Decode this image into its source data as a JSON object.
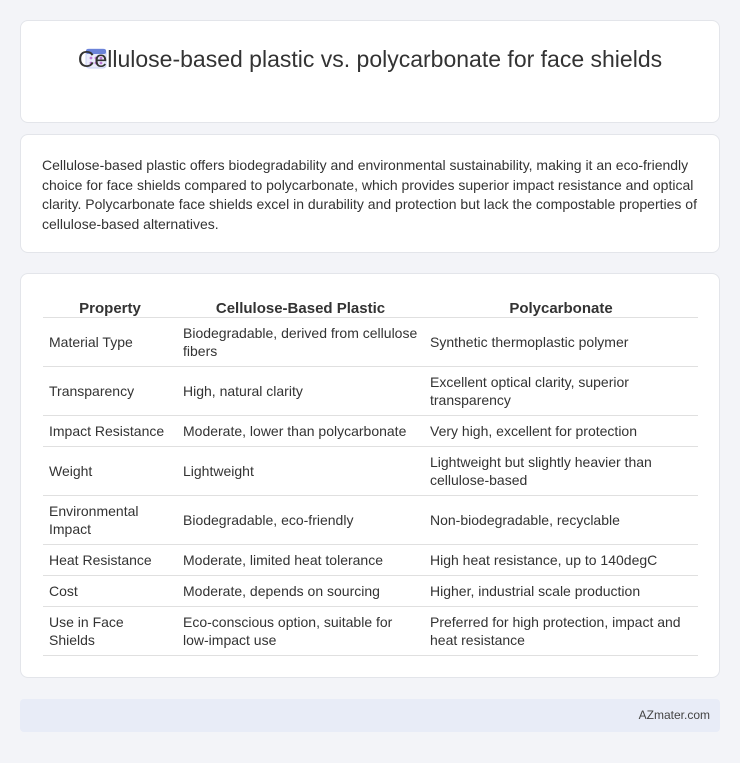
{
  "header": {
    "title": "Cellulose-based plastic vs. polycarbonate for face shields",
    "icon": "calendar-icon",
    "icon_color": "#6b83d9"
  },
  "summary": {
    "text": "Cellulose-based plastic offers biodegradability and environmental sustainability, making it an eco-friendly choice for face shields compared to polycarbonate, which provides superior impact resistance and optical clarity. Polycarbonate face shields excel in durability and protection but lack the compostable properties of cellulose-based alternatives."
  },
  "table": {
    "columns": [
      "Property",
      "Cellulose-Based Plastic",
      "Polycarbonate"
    ],
    "rows": [
      [
        "Material Type",
        "Biodegradable, derived from cellulose fibers",
        "Synthetic thermoplastic polymer"
      ],
      [
        "Transparency",
        "High, natural clarity",
        "Excellent optical clarity, superior transparency"
      ],
      [
        "Impact Resistance",
        "Moderate, lower than polycarbonate",
        "Very high, excellent for protection"
      ],
      [
        "Weight",
        "Lightweight",
        "Lightweight but slightly heavier than cellulose-based"
      ],
      [
        "Environmental Impact",
        "Biodegradable, eco-friendly",
        "Non-biodegradable, recyclable"
      ],
      [
        "Heat Resistance",
        "Moderate, limited heat tolerance",
        "High heat resistance, up to 140degC"
      ],
      [
        "Cost",
        "Moderate, depends on sourcing",
        "Higher, industrial scale production"
      ],
      [
        "Use in Face Shields",
        "Eco-conscious option, suitable for low-impact use",
        "Preferred for high protection, impact and heat resistance"
      ]
    ]
  },
  "footer": {
    "site": "AZmater.com"
  }
}
